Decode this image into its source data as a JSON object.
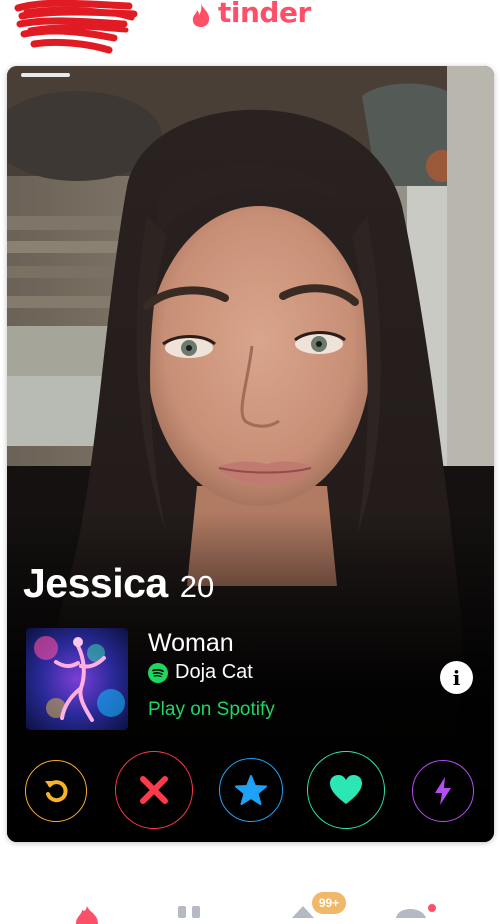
{
  "app": {
    "logo_text": "tinder",
    "brand_color": "#fd5068"
  },
  "profile": {
    "name": "Jessica",
    "age": "20",
    "gender": "Woman",
    "anthem": {
      "artist": "Doja Cat",
      "link_label": "Play on Spotify",
      "service_icon": "spotify-icon",
      "accent_color": "#1ed760"
    },
    "photo_count_indicator": 1
  },
  "actions": [
    {
      "name": "rewind",
      "icon": "rewind-icon",
      "color": "#f7b32b"
    },
    {
      "name": "nope",
      "icon": "close-icon",
      "color": "#fd3a4a"
    },
    {
      "name": "super-like",
      "icon": "star-icon",
      "color": "#1fa1f6"
    },
    {
      "name": "like",
      "icon": "heart-icon",
      "color": "#2ce7b4"
    },
    {
      "name": "boost",
      "icon": "lightning-icon",
      "color": "#b44ef2"
    }
  ],
  "bottom_nav": {
    "likes_badge": "99+",
    "items": [
      {
        "icon": "flame-icon"
      },
      {
        "icon": "explore-icon"
      },
      {
        "icon": "likes-icon"
      },
      {
        "icon": "chat-icon"
      }
    ]
  }
}
